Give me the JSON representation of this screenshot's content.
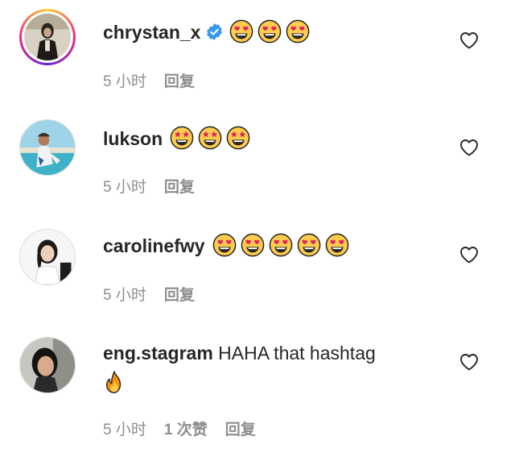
{
  "comments": [
    {
      "username": "chrystan_x",
      "verified": true,
      "text": "",
      "emojis": [
        "heart-eyes",
        "heart-eyes",
        "heart-eyes"
      ],
      "time": "5 小时",
      "likes": "",
      "reply": "回复"
    },
    {
      "username": "lukson",
      "verified": false,
      "text": "",
      "emojis": [
        "star-struck",
        "star-struck",
        "star-struck"
      ],
      "time": "5 小时",
      "likes": "",
      "reply": "回复"
    },
    {
      "username": "carolinefwy",
      "verified": false,
      "text": "",
      "emojis": [
        "heart-eyes",
        "heart-eyes",
        "heart-eyes",
        "heart-eyes",
        "heart-eyes"
      ],
      "time": "5 小时",
      "likes": "",
      "reply": "回复"
    },
    {
      "username": "eng.stagram",
      "verified": false,
      "text": "HAHA that hashtag",
      "emojis": [
        "fire"
      ],
      "time": "5 小时",
      "likes": "1 次赞",
      "reply": "回复"
    }
  ],
  "icons": {
    "like": "heart-outline-icon",
    "verified": "verified-badge-icon"
  },
  "colors": {
    "text": "#262626",
    "meta": "#8e8e8e",
    "verified": "#3897f0",
    "story_ring": "#ee2a7b"
  }
}
